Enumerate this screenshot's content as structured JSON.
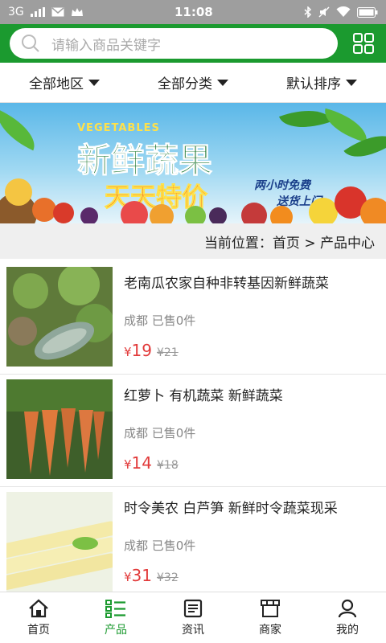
{
  "status": {
    "network": "3G",
    "time": "11:08"
  },
  "search": {
    "placeholder": "请输入商品关键字"
  },
  "filters": [
    {
      "label": "全部地区"
    },
    {
      "label": "全部分类"
    },
    {
      "label": "默认排序"
    }
  ],
  "banner": {
    "en_title": "VEGETABLES",
    "title": "新鲜蔬果",
    "subtitle": "天天特价",
    "tag_line1": "两小时免费",
    "tag_line2": "送货上门"
  },
  "breadcrumb": "当前位置：首页 > 产品中心",
  "products": [
    {
      "title": "老南瓜农家自种非转基因新鲜蔬菜",
      "meta": "成都 已售0件",
      "currency": "¥",
      "price": "19",
      "old_price": "¥21"
    },
    {
      "title": "红萝卜 有机蔬菜 新鲜蔬菜",
      "meta": "成都 已售0件",
      "currency": "¥",
      "price": "14",
      "old_price": "¥18"
    },
    {
      "title": "时令美农 白芦笋 新鲜时令蔬菜现采",
      "meta": "成都 已售0件",
      "currency": "¥",
      "price": "31",
      "old_price": "¥32"
    }
  ],
  "tabbar": [
    {
      "label": "首页",
      "icon": "home-icon"
    },
    {
      "label": "产品",
      "icon": "list-icon"
    },
    {
      "label": "资讯",
      "icon": "news-icon"
    },
    {
      "label": "商家",
      "icon": "shop-icon"
    },
    {
      "label": "我的",
      "icon": "user-icon"
    }
  ],
  "colors": {
    "brand": "#1b9a2f",
    "price": "#e23a3a",
    "status_bar": "#9e9e9e"
  }
}
